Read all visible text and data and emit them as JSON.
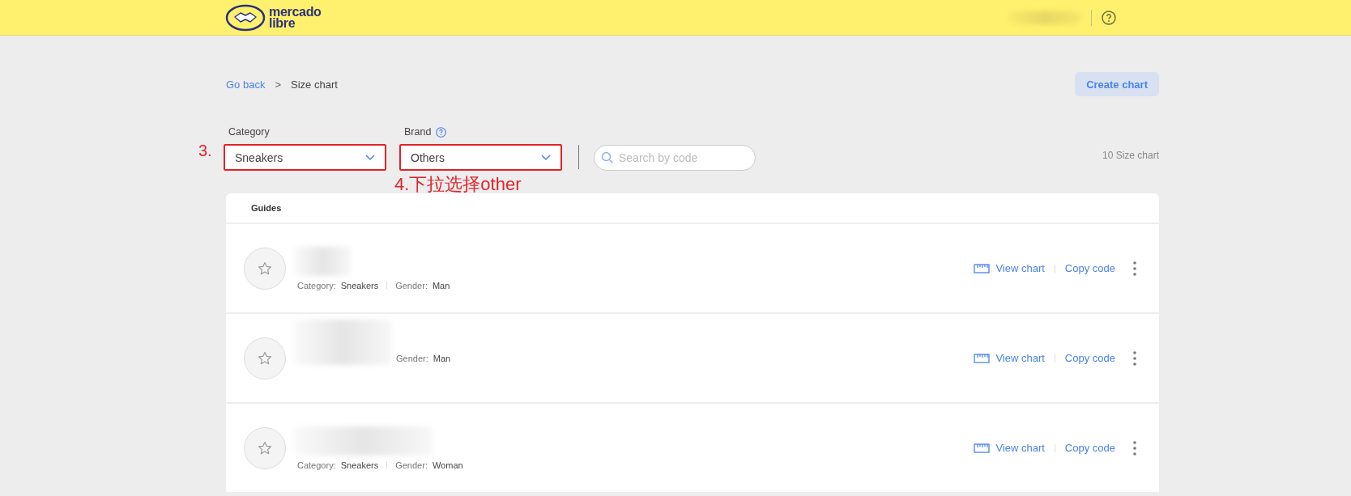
{
  "header": {
    "logo_text": [
      "mercado",
      "libre"
    ]
  },
  "breadcrumb": {
    "back_link": "Go back",
    "separator": ">",
    "current": "Size chart"
  },
  "create_button": "Create chart",
  "filters": [
    {
      "label": "Category",
      "value": "Sneakers",
      "has_help": false,
      "highlighted": true,
      "annotation": "3."
    },
    {
      "label": "Brand",
      "value": "Others",
      "has_help": true,
      "highlighted": true,
      "annotation": "4.下拉选择other"
    }
  ],
  "search": {
    "placeholder": "Search by code"
  },
  "count": "10 Size chart",
  "list": {
    "heading": "Guides",
    "rows": [
      {
        "meta": [
          {
            "label": "Category:",
            "value": "Sneakers"
          },
          {
            "label": "Gender:",
            "value": "Man"
          }
        ],
        "view": "View chart",
        "copy": "Copy code"
      },
      {
        "meta": [
          {
            "label": "Gender:",
            "value": "Man"
          }
        ],
        "view": "View chart",
        "copy": "Copy code"
      },
      {
        "meta": [
          {
            "label": "Category:",
            "value": "Sneakers"
          },
          {
            "label": "Gender:",
            "value": "Woman"
          }
        ],
        "view": "View chart",
        "copy": "Copy code"
      }
    ]
  }
}
